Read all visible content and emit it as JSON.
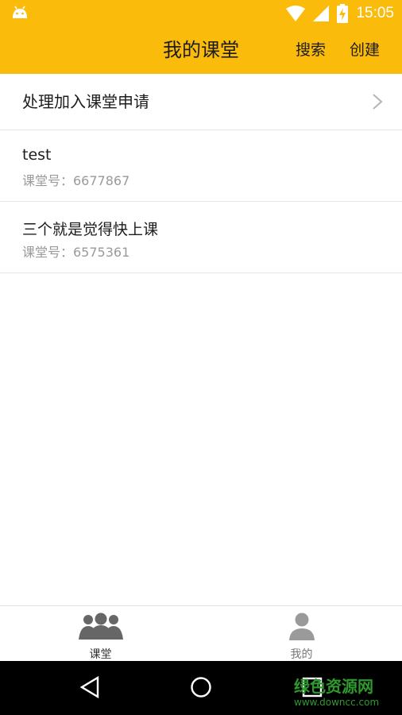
{
  "status_bar": {
    "time": "15:05",
    "colors": {
      "background": "#fbbb0a"
    }
  },
  "header": {
    "title": "我的课堂",
    "search_label": "搜索",
    "create_label": "创建"
  },
  "join_requests": {
    "label": "处理加入课堂申请"
  },
  "classes": [
    {
      "name": "test",
      "number": "课堂号：6677867"
    },
    {
      "name": "三个就是觉得快上课",
      "number": "课堂号：6575361"
    }
  ],
  "bottom_nav": {
    "tabs": [
      {
        "label": "课堂",
        "icon": "group-icon",
        "active": true
      },
      {
        "label": "我的",
        "icon": "person-icon",
        "active": false
      }
    ]
  },
  "system_nav": {
    "buttons": [
      "back-icon",
      "home-icon",
      "recents-icon"
    ]
  },
  "watermark": {
    "line1": "绿色资源网",
    "line2": "www.downcc.com"
  }
}
